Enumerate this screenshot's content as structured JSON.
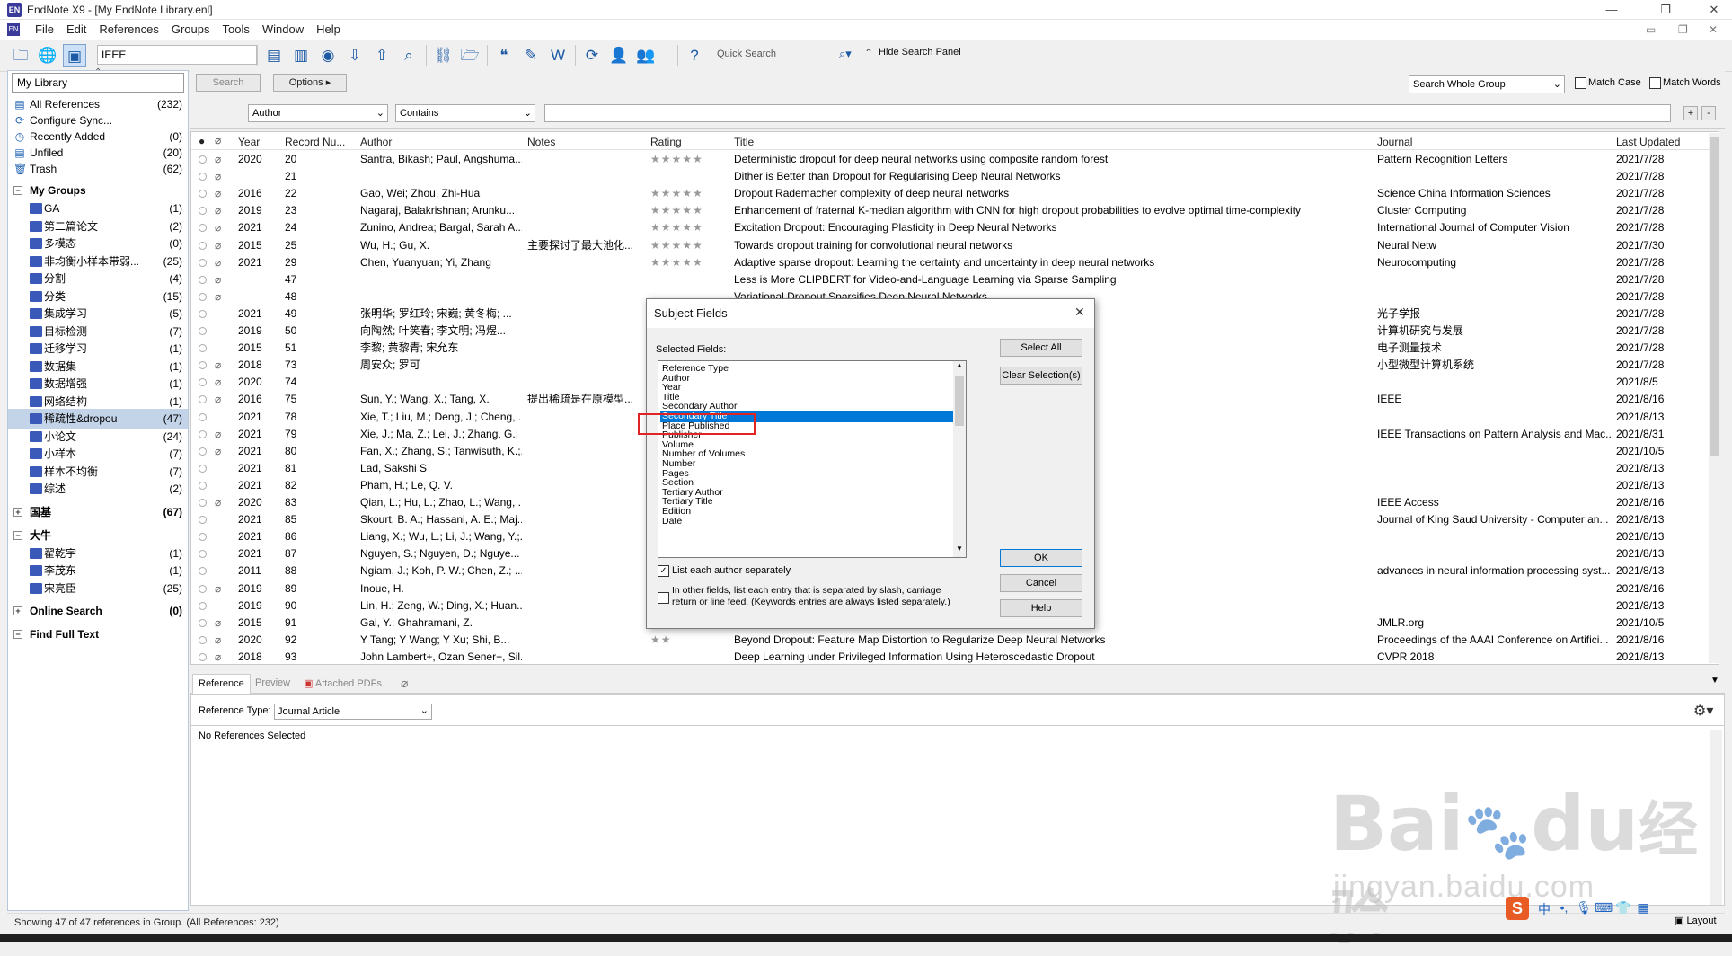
{
  "window": {
    "title": "EndNote X9 - [My EndNote Library.enl]",
    "logo": "EN"
  },
  "menu": [
    "File",
    "Edit",
    "References",
    "Groups",
    "Tools",
    "Window",
    "Help"
  ],
  "toolbar": {
    "style": "IEEE",
    "quick_search_placeholder": "Quick Search",
    "hide_search_panel": "Hide Search Panel"
  },
  "library": {
    "selector": "My Library",
    "items": [
      {
        "label": "All References",
        "count": "(232)",
        "icon": "book-icon"
      },
      {
        "label": "Configure Sync...",
        "count": "",
        "icon": "sync-icon"
      },
      {
        "label": "Recently Added",
        "count": "(0)",
        "icon": "clock-icon"
      },
      {
        "label": "Unfiled",
        "count": "(20)",
        "icon": "folder-icon"
      },
      {
        "label": "Trash",
        "count": "(62)",
        "icon": "trash-icon"
      }
    ],
    "my_groups_header": "My Groups",
    "groups": [
      {
        "label": "GA",
        "count": "(1)"
      },
      {
        "label": "第二篇论文",
        "count": "(2)"
      },
      {
        "label": "多模态",
        "count": "(0)"
      },
      {
        "label": "非均衡小样本带弱...",
        "count": "(25)"
      },
      {
        "label": "分割",
        "count": "(4)"
      },
      {
        "label": "分类",
        "count": "(15)"
      },
      {
        "label": "集成学习",
        "count": "(5)"
      },
      {
        "label": "目标检测",
        "count": "(7)"
      },
      {
        "label": "迁移学习",
        "count": "(1)"
      },
      {
        "label": "数据集",
        "count": "(1)"
      },
      {
        "label": "数据增强",
        "count": "(1)"
      },
      {
        "label": "网络结构",
        "count": "(1)"
      },
      {
        "label": "稀疏性&dropou",
        "count": "(47)"
      },
      {
        "label": "小论文",
        "count": "(24)"
      },
      {
        "label": "小样本",
        "count": "(7)"
      },
      {
        "label": "样本不均衡",
        "count": "(7)"
      },
      {
        "label": "综述",
        "count": "(2)"
      }
    ],
    "guoji": {
      "label": "国基",
      "count": "(67)"
    },
    "daniu": {
      "label": "大牛",
      "groups": [
        {
          "label": "翟乾宇",
          "count": "(1)"
        },
        {
          "label": "李茂东",
          "count": "(1)"
        },
        {
          "label": "宋亮臣",
          "count": "(25)"
        }
      ]
    },
    "online_search": {
      "label": "Online Search",
      "count": "(0)"
    },
    "find_full_text": "Find Full Text"
  },
  "search": {
    "search_btn": "Search",
    "options_btn": "Options",
    "scope": "Search Whole Group",
    "match_case": "Match Case",
    "match_words": "Match Words",
    "field": "Author",
    "operator": "Contains"
  },
  "columns": [
    "Year",
    "Record Nu...",
    "Author",
    "Notes",
    "Rating",
    "Title",
    "Journal",
    "Last Updated"
  ],
  "rows": [
    {
      "clip": true,
      "year": "2020",
      "rec": "20",
      "author": "Santra, Bikash; Paul, Angshuma...",
      "notes": "",
      "rating": "★★★★★",
      "title": "Deterministic dropout for deep neural networks using composite random forest",
      "journal": "Pattern Recognition Letters",
      "updated": "2021/7/28"
    },
    {
      "clip": true,
      "year": "",
      "rec": "21",
      "author": "",
      "notes": "",
      "rating": "",
      "title": "Dither is Better than Dropout for Regularising Deep Neural Networks",
      "journal": "",
      "updated": "2021/7/28"
    },
    {
      "clip": true,
      "year": "2016",
      "rec": "22",
      "author": "Gao, Wei; Zhou, Zhi-Hua",
      "notes": "",
      "rating": "★★★★★",
      "title": "Dropout Rademacher complexity of deep neural networks",
      "journal": "Science China Information Sciences",
      "updated": "2021/7/28"
    },
    {
      "clip": true,
      "year": "2019",
      "rec": "23",
      "author": "Nagaraj, Balakrishnan; Arunku...",
      "notes": "",
      "rating": "★★★★★",
      "title": "Enhancement of fraternal K-median algorithm with CNN for high dropout probabilities to evolve optimal time-complexity",
      "journal": "Cluster Computing",
      "updated": "2021/7/28"
    },
    {
      "clip": true,
      "year": "2021",
      "rec": "24",
      "author": "Zunino, Andrea; Bargal, Sarah A...",
      "notes": "",
      "rating": "★★★★★",
      "title": "Excitation Dropout: Encouraging Plasticity in Deep Neural Networks",
      "journal": "International Journal of Computer Vision",
      "updated": "2021/7/28"
    },
    {
      "clip": true,
      "year": "2015",
      "rec": "25",
      "author": "Wu, H.; Gu, X.",
      "notes": "主要探讨了最大池化...",
      "rating": "★★★★★",
      "title": "Towards dropout training for convolutional neural networks",
      "journal": "Neural Netw",
      "updated": "2021/7/30"
    },
    {
      "clip": true,
      "year": "2021",
      "rec": "29",
      "author": "Chen, Yuanyuan; Yi, Zhang",
      "notes": "",
      "rating": "★★★★★",
      "title": "Adaptive sparse dropout: Learning the certainty and uncertainty in deep neural networks",
      "journal": "Neurocomputing",
      "updated": "2021/7/28"
    },
    {
      "clip": true,
      "year": "",
      "rec": "47",
      "author": "",
      "notes": "",
      "rating": "",
      "title": "Less is More CLIPBERT for Video-and-Language Learning via Sparse Sampling",
      "journal": "",
      "updated": "2021/7/28"
    },
    {
      "clip": true,
      "year": "",
      "rec": "48",
      "author": "",
      "notes": "",
      "rating": "",
      "title": "Variational Dropout Sparsifies Deep Neural Networks",
      "journal": "",
      "updated": "2021/7/28"
    },
    {
      "clip": false,
      "year": "2021",
      "rec": "49",
      "author": "张明华; 罗红玲; 宋巍; 黄冬梅; ...",
      "notes": "",
      "rating": "",
      "title": "",
      "journal": "光子学报",
      "updated": "2021/7/28"
    },
    {
      "clip": false,
      "year": "2019",
      "rec": "50",
      "author": "向陶然; 叶笑春; 李文明; 冯煜...",
      "notes": "",
      "rating": "",
      "title": "",
      "journal": "计算机研究与发展",
      "updated": "2021/7/28"
    },
    {
      "clip": false,
      "year": "2015",
      "rec": "51",
      "author": "李黎; 黄黎青; 宋允东",
      "notes": "",
      "rating": "",
      "title": "",
      "journal": "电子测量技术",
      "updated": "2021/7/28"
    },
    {
      "clip": true,
      "year": "2018",
      "rec": "73",
      "author": "周安众; 罗可",
      "notes": "",
      "rating": "",
      "title": "",
      "journal": "小型微型计算机系统",
      "updated": "2021/7/28"
    },
    {
      "clip": true,
      "year": "2020",
      "rec": "74",
      "author": "",
      "notes": "",
      "rating": "",
      "title": "",
      "journal": "",
      "updated": "2021/8/5"
    },
    {
      "clip": true,
      "year": "2016",
      "rec": "75",
      "author": "Sun, Y.; Wang, X.; Tang, X.",
      "notes": "提出稀疏是在原模型...",
      "rating": "",
      "title": "",
      "journal": "IEEE",
      "updated": "2021/8/16"
    },
    {
      "clip": false,
      "year": "2021",
      "rec": "78",
      "author": "Xie, T.; Liu, M.; Deng, J.; Cheng, ...",
      "notes": "",
      "rating": "",
      "title": "",
      "journal": "",
      "updated": "2021/8/13"
    },
    {
      "clip": true,
      "year": "2021",
      "rec": "79",
      "author": "Xie, J.; Ma, Z.; Lei, J.; Zhang, G.; ...",
      "notes": "",
      "rating": "",
      "title": "ization",
      "journal": "IEEE Transactions on Pattern Analysis and Mac...",
      "updated": "2021/8/31"
    },
    {
      "clip": true,
      "year": "2021",
      "rec": "80",
      "author": "Fan, X.; Zhang, S.; Tanwisuth, K.;...",
      "notes": "",
      "rating": "",
      "title": "",
      "journal": "",
      "updated": "2021/10/5"
    },
    {
      "clip": false,
      "year": "2021",
      "rec": "81",
      "author": "Lad, Sakshi S",
      "notes": "",
      "rating": "",
      "title": "",
      "journal": "",
      "updated": "2021/8/13"
    },
    {
      "clip": false,
      "year": "2021",
      "rec": "82",
      "author": "Pham, H.; Le, Q. V.",
      "notes": "",
      "rating": "",
      "title": "",
      "journal": "",
      "updated": "2021/8/13"
    },
    {
      "clip": true,
      "year": "2020",
      "rec": "83",
      "author": "Qian, L.; Hu, L.; Zhao, L.; Wang, ...",
      "notes": "",
      "rating": "",
      "title": "cation",
      "journal": "IEEE Access",
      "updated": "2021/8/16"
    },
    {
      "clip": false,
      "year": "2021",
      "rec": "85",
      "author": "Skourt, B. A.; Hassani, A. E.; Maj...",
      "notes": "",
      "rating": "",
      "title": "",
      "journal": "Journal of King Saud University - Computer an...",
      "updated": "2021/8/13"
    },
    {
      "clip": false,
      "year": "2021",
      "rec": "86",
      "author": "Liang, X.; Wu, L.; Li, J.; Wang, Y.;...",
      "notes": "",
      "rating": "",
      "title": "",
      "journal": "",
      "updated": "2021/8/13"
    },
    {
      "clip": false,
      "year": "2021",
      "rec": "87",
      "author": "Nguyen, S.; Nguyen, D.; Nguye...",
      "notes": "",
      "rating": "",
      "title": "ctured Dropout",
      "journal": "",
      "updated": "2021/8/13"
    },
    {
      "clip": false,
      "year": "2011",
      "rec": "88",
      "author": "Ngiam, J.; Koh, P. W.; Chen, Z.; ...",
      "notes": "",
      "rating": "",
      "title": "",
      "journal": "advances in neural information processing syst...",
      "updated": "2021/8/13"
    },
    {
      "clip": true,
      "year": "2019",
      "rec": "89",
      "author": "Inoue, H.",
      "notes": "",
      "rating": "",
      "title": "",
      "journal": "",
      "updated": "2021/8/16"
    },
    {
      "clip": false,
      "year": "2019",
      "rec": "90",
      "author": "Lin, H.; Zeng, W.; Ding, X.; Huan...",
      "notes": "",
      "rating": "",
      "title": "",
      "journal": "",
      "updated": "2021/8/13"
    },
    {
      "clip": true,
      "year": "2015",
      "rec": "91",
      "author": "Gal, Y.; Ghahramani, Z.",
      "notes": "",
      "rating": "",
      "title": "eep Learning",
      "journal": "JMLR.org",
      "updated": "2021/10/5"
    },
    {
      "clip": true,
      "year": "2020",
      "rec": "92",
      "author": "Y Tang; Y Wang; Y Xu; Shi, B...",
      "notes": "",
      "rating": "★★",
      "title": "Beyond Dropout: Feature Map Distortion to Regularize Deep Neural Networks",
      "journal": "Proceedings of the AAAI Conference on Artifici...",
      "updated": "2021/8/16"
    },
    {
      "clip": true,
      "year": "2018",
      "rec": "93",
      "author": "John Lambert+, Ozan Sener+, Sil...",
      "notes": "",
      "rating": "",
      "title": "Deep Learning under Privileged Information Using Heteroscedastic Dropout",
      "journal": "CVPR 2018",
      "updated": "2021/8/13"
    }
  ],
  "tabs": {
    "reference": "Reference",
    "preview": "Preview",
    "attached_pdfs": "Attached PDFs"
  },
  "editor": {
    "ref_type_label": "Reference Type:",
    "ref_type_value": "Journal Article",
    "no_refs": "No References Selected",
    "layout": "Layout"
  },
  "status": "Showing 47 of 47 references in Group. (All References: 232)",
  "dialog": {
    "title": "Subject Fields",
    "selected_fields_label": "Selected Fields:",
    "fields": [
      "Reference Type",
      "Author",
      "Year",
      "Title",
      "Secondary Author",
      "Secondary Title",
      "Place Published",
      "Publisher",
      "Volume",
      "Number of Volumes",
      "Number",
      "Pages",
      "Section",
      "Tertiary Author",
      "Tertiary Title",
      "Edition",
      "Date"
    ],
    "selected_index": 5,
    "select_all": "Select All",
    "clear_selection": "Clear Selection(s)",
    "ok": "OK",
    "cancel": "Cancel",
    "help": "Help",
    "list_each_author": "List each author separately",
    "other_fields_line1": "In other fields, list each entry that is separated by slash, carriage",
    "other_fields_line2": "return or line feed. (Keywords entries are always listed separately.)"
  },
  "watermark": {
    "brand": "Bai",
    "brand2": "du",
    "cn": "经验",
    "url": "jingyan.baidu.com"
  },
  "tray": {
    "ime": "中"
  }
}
